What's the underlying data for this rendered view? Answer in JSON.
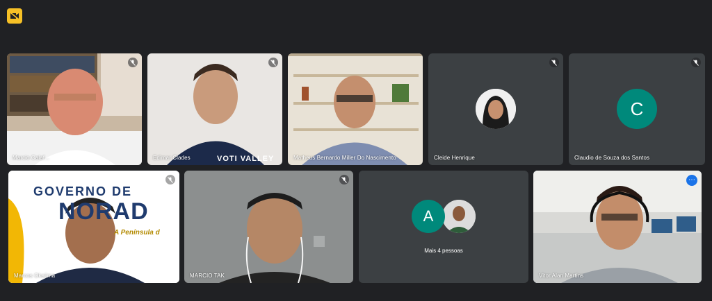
{
  "meeting": {
    "top_icon": "camera-off-icon",
    "tiles_row1": [
      {
        "name": "Marcio Calaf..."
      },
      {
        "name": "Edimar Clades"
      },
      {
        "name": "Matheus Bernardo Miller Do Nascimento"
      },
      {
        "name": "Cleide Henrique"
      },
      {
        "name": "Claudio de Souza dos Santos",
        "initial": "C"
      }
    ],
    "tiles_row2": [
      {
        "name": "Marcos Okajima",
        "banner_line1": "GOVERNO DE",
        "banner_line2": "NORAD",
        "banner_sub": "A Península d"
      },
      {
        "name": "MARCIO TAK"
      },
      {
        "name": "Mais 4 pessoas",
        "initial": "A"
      },
      {
        "name": "Vitor Alan Martins"
      }
    ],
    "shirt_text": "VOTI VALLEY",
    "colors": {
      "background": "#202124",
      "tile": "#3c4043",
      "accent_blue": "#1a73e8",
      "avatar_teal": "#00897b"
    }
  }
}
